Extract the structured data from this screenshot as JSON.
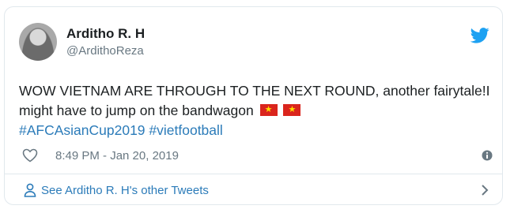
{
  "tweet": {
    "author_name": "Arditho R. H",
    "author_handle": "@ArdithoReza",
    "text": "WOW VIETNAM ARE THROUGH TO THE NEXT ROUND, another fairytale!I might have to jump on the bandwagon",
    "flags": [
      "vietnam-flag-icon",
      "vietnam-flag-icon"
    ],
    "hashtags": "#AFCAsianCup2019 #vietfootball",
    "timestamp": "8:49 PM - Jan 20, 2019"
  },
  "footer": {
    "label": "See Arditho R. H's other Tweets"
  },
  "icons": {
    "brand": "twitter-bird-icon",
    "like": "heart-icon",
    "info": "info-icon",
    "person": "person-icon",
    "chevron": "chevron-right-icon"
  },
  "colors": {
    "link": "#2b7bb9",
    "twitter_blue": "#1da1f2",
    "muted": "#697882",
    "flag_red": "#da251d",
    "flag_star": "#ffdd00"
  }
}
